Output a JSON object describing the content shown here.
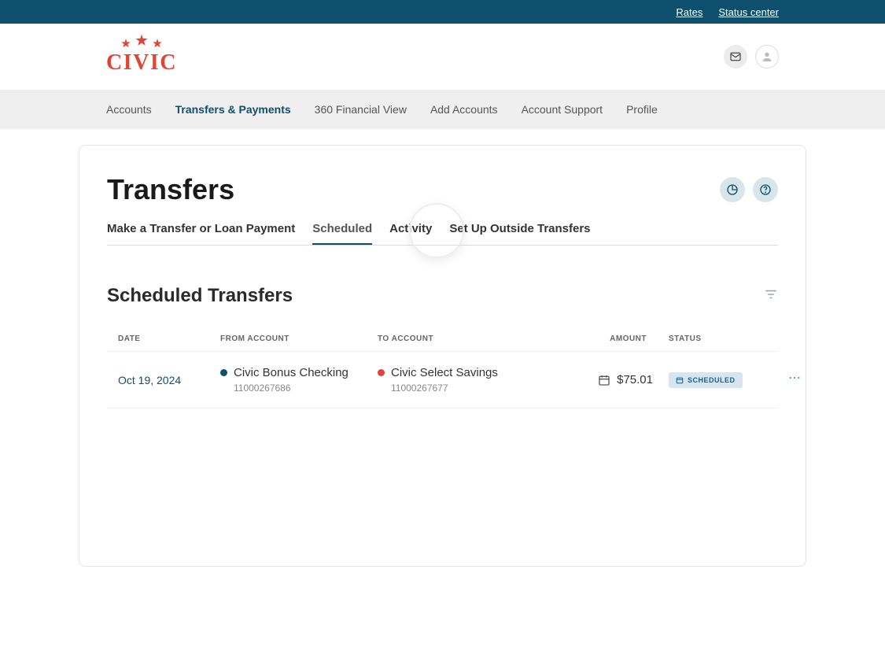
{
  "topbar": {
    "rates": "Rates",
    "status_center": "Status center"
  },
  "logo": {
    "text": "CIVIC"
  },
  "nav": {
    "accounts": "Accounts",
    "transfers": "Transfers & Payments",
    "financial_view": "360 Financial View",
    "add_accounts": "Add Accounts",
    "support": "Account Support",
    "profile": "Profile"
  },
  "page": {
    "title": "Transfers"
  },
  "tabs": {
    "make": "Make a Transfer or Loan Payment",
    "scheduled": "Scheduled",
    "activity": "Activity",
    "outside": "Set Up Outside Transfers"
  },
  "section": {
    "title": "Scheduled Transfers"
  },
  "table": {
    "headers": {
      "date": "DATE",
      "from": "FROM ACCOUNT",
      "to": "TO ACCOUNT",
      "amount": "AMOUNT",
      "status": "STATUS"
    },
    "rows": [
      {
        "date": "Oct 19, 2024",
        "from_name": "Civic Bonus Checking",
        "from_num": "11000267686",
        "to_name": "Civic Select Savings",
        "to_num": "11000267677",
        "amount": "$75.01",
        "status": "SCHEDULED"
      }
    ]
  }
}
